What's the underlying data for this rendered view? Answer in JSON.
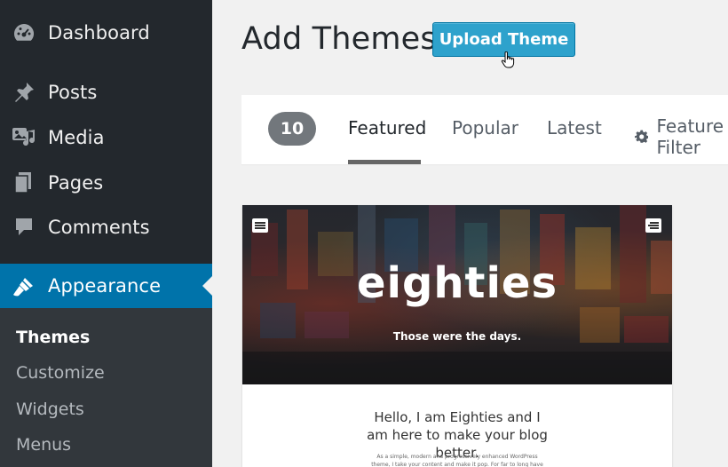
{
  "sidebar": {
    "items": [
      {
        "label": "Dashboard",
        "icon": "dashboard-icon"
      },
      {
        "label": "Posts",
        "icon": "pin-icon"
      },
      {
        "label": "Media",
        "icon": "media-icon"
      },
      {
        "label": "Pages",
        "icon": "pages-icon"
      },
      {
        "label": "Comments",
        "icon": "comment-icon"
      },
      {
        "label": "Appearance",
        "icon": "brush-icon",
        "active": true
      }
    ],
    "submenu": [
      "Themes",
      "Customize",
      "Widgets",
      "Menus"
    ],
    "current_submenu": "Themes"
  },
  "header": {
    "title": "Add Themes",
    "upload_label": "Upload Theme"
  },
  "filter": {
    "count": "10",
    "tabs": [
      "Featured",
      "Popular",
      "Latest"
    ],
    "active_tab": "Featured",
    "feature_filter": "Feature Filter"
  },
  "theme": {
    "name": "eighties",
    "tagline": "Those were the days.",
    "intro": "Hello, I am Eighties and I am here to make your blog better.",
    "description": "As a simple, modern and progressively enhanced WordPress theme, I take your content and make it pop. For far to long have distracted"
  },
  "colors": {
    "sidebar_bg": "#23282d",
    "accent": "#0073aa",
    "button": "#2ea2cc"
  }
}
